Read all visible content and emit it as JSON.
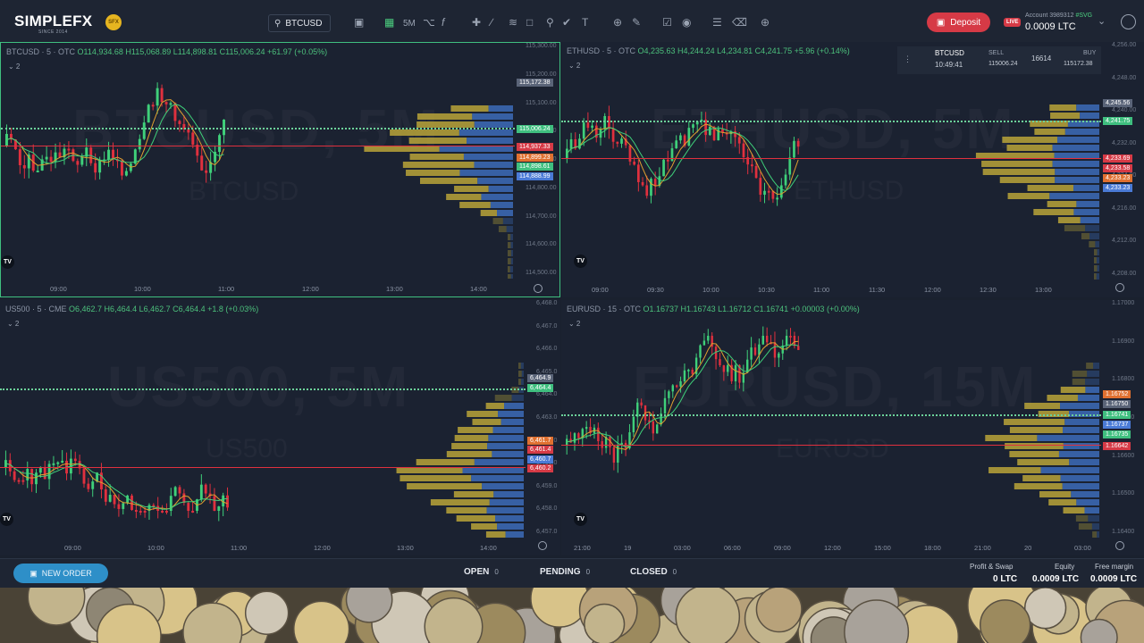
{
  "app": {
    "logo": "SIMPLEFX",
    "logo_sub": "SINCE 2014",
    "sfx_badge": "SFX"
  },
  "toolbar": {
    "symbol_search": "BTCUSD",
    "timeframe": "5M",
    "icons": [
      "search-icon",
      "camera-icon",
      "layout-icon",
      "candles-icon",
      "formula-icon",
      "crosshair-icon",
      "trendline-icon",
      "fib-icon",
      "rectangle-icon",
      "pin-icon",
      "pattern-icon",
      "text-tool-icon",
      "zoom-in-icon",
      "ruler-icon",
      "lock-icon",
      "eye-off-icon",
      "layers-icon",
      "trash-icon",
      "chevron-icon"
    ]
  },
  "account": {
    "deposit_label": "Deposit",
    "live_badge": "LIVE",
    "account_label": "Account 3989312",
    "account_tag": "#SVG",
    "balance": "0.0009 LTC"
  },
  "quote_widget": {
    "symbol": "BTCUSD",
    "time": "10:49:41",
    "sell_label": "SELL",
    "sell_price": "115006.24",
    "spread": "16614",
    "buy_label": "BUY",
    "buy_price": "115172.38"
  },
  "panels": [
    {
      "id": "btc",
      "header_title": "BTCUSD · 5 · OTC",
      "ohlc": "O114,934.68 H115,068.89 L114,898.81 C115,006.24 +61.97 (+0.05%)",
      "indicator_count": "2",
      "watermark": "BTCUSD, 5M",
      "watermark_sub": "BTCUSD",
      "price_labels": [
        "115,300.00",
        "115,200.00",
        "115,100.00",
        "115,000.00",
        "114,900.00",
        "114,800.00",
        "114,700.00",
        "114,600.00",
        "114,500.00"
      ],
      "price_tags": [
        {
          "text": "115,172.38",
          "color": "#5a6478"
        },
        {
          "text": "115,006.24",
          "color": "#3fbf7f"
        },
        {
          "text": "114,937.33",
          "color": "#d63a46"
        },
        {
          "text": "114,899.23",
          "color": "#e07030"
        },
        {
          "text": "114,898.61",
          "color": "#3fbf7f"
        },
        {
          "text": "114,888.99",
          "color": "#4a7ad6"
        }
      ],
      "time_labels": [
        "09:00",
        "10:00",
        "11:00",
        "12:00",
        "13:00",
        "14:00"
      ]
    },
    {
      "id": "eth",
      "header_title": "ETHUSD · 5 · OTC",
      "ohlc": "O4,235.63 H4,244.24 L4,234.81 C4,241.75 +5.96 (+0.14%)",
      "indicator_count": "2",
      "watermark": "ETHUSD, 5M",
      "watermark_sub": "ETHUSD",
      "price_labels": [
        "4,256.00",
        "4,248.00",
        "4,240.00",
        "4,232.00",
        "4,224.00",
        "4,216.00",
        "4,212.00",
        "4,208.00"
      ],
      "price_tags": [
        {
          "text": "4,245.56",
          "color": "#5a6478"
        },
        {
          "text": "4,241.75",
          "color": "#3fbf7f"
        },
        {
          "text": "4,233.69",
          "color": "#d63a46"
        },
        {
          "text": "4,233.58",
          "color": "#d63a46"
        },
        {
          "text": "4,233.23",
          "color": "#e07030"
        },
        {
          "text": "4,233.23",
          "color": "#4a7ad6"
        }
      ],
      "time_labels": [
        "09:00",
        "09:30",
        "10:00",
        "10:30",
        "11:00",
        "11:30",
        "12:00",
        "12:30",
        "13:00"
      ]
    },
    {
      "id": "us500",
      "header_title": "US500 · 5 · CME",
      "ohlc": "O6,462.7 H6,464.4 L6,462.7 C6,464.4 +1.8 (+0.03%)",
      "indicator_count": "2",
      "watermark": "US500, 5M",
      "watermark_sub": "US500",
      "price_labels": [
        "6,468.0",
        "6,467.0",
        "6,466.0",
        "6,465.0",
        "6,464.0",
        "6,463.0",
        "6,462.0",
        "6,460.0",
        "6,459.0",
        "6,458.0",
        "6,457.0"
      ],
      "price_tags": [
        {
          "text": "6,464.9",
          "color": "#5a6478"
        },
        {
          "text": "6,464.4",
          "color": "#3fbf7f"
        },
        {
          "text": "6,461.7",
          "color": "#e07030"
        },
        {
          "text": "6,461.4",
          "color": "#d63a46"
        },
        {
          "text": "6,460.7",
          "color": "#4a7ad6"
        },
        {
          "text": "6,460.2",
          "color": "#d63a46"
        }
      ],
      "time_labels": [
        "09:00",
        "10:00",
        "11:00",
        "12:00",
        "13:00",
        "14:00"
      ]
    },
    {
      "id": "eur",
      "header_title": "EURUSD · 15 · OTC",
      "ohlc": "O1.16737 H1.16743 L1.16712 C1.16741 +0.00003 (+0.00%)",
      "indicator_count": "2",
      "watermark": "EURUSD, 15M",
      "watermark_sub": "EURUSD",
      "price_labels": [
        "1.17000",
        "1.16900",
        "1.16800",
        "1.16700",
        "1.16600",
        "1.16500",
        "1.16400"
      ],
      "price_tags": [
        {
          "text": "1.16752",
          "color": "#e07030"
        },
        {
          "text": "1.16750",
          "color": "#5a6478"
        },
        {
          "text": "1.16741",
          "color": "#3fbf7f"
        },
        {
          "text": "1.16737",
          "color": "#4a7ad6"
        },
        {
          "text": "1.16735",
          "color": "#3fbf7f"
        },
        {
          "text": "1.16642",
          "color": "#d63a46"
        }
      ],
      "time_labels": [
        "21:00",
        "19",
        "03:00",
        "06:00",
        "09:00",
        "12:00",
        "15:00",
        "18:00",
        "21:00",
        "20",
        "03:00"
      ]
    }
  ],
  "bottom": {
    "new_order_label": "NEW ORDER",
    "tabs": [
      {
        "label": "OPEN",
        "count": "0"
      },
      {
        "label": "PENDING",
        "count": "0"
      },
      {
        "label": "CLOSED",
        "count": "0"
      }
    ],
    "profit_label": "Profit & Swap",
    "profit_value": "0 LTC",
    "equity_label": "Equity",
    "equity_value": "0.0009 LTC",
    "margin_label": "Free margin",
    "margin_value": "0.0009 LTC"
  },
  "colors": {
    "bull": "#3fd07a",
    "bear": "#e0303e",
    "volume_gold": "#b8a338",
    "volume_blue": "#3c6bb8",
    "accent_green": "#3fbf7f"
  }
}
